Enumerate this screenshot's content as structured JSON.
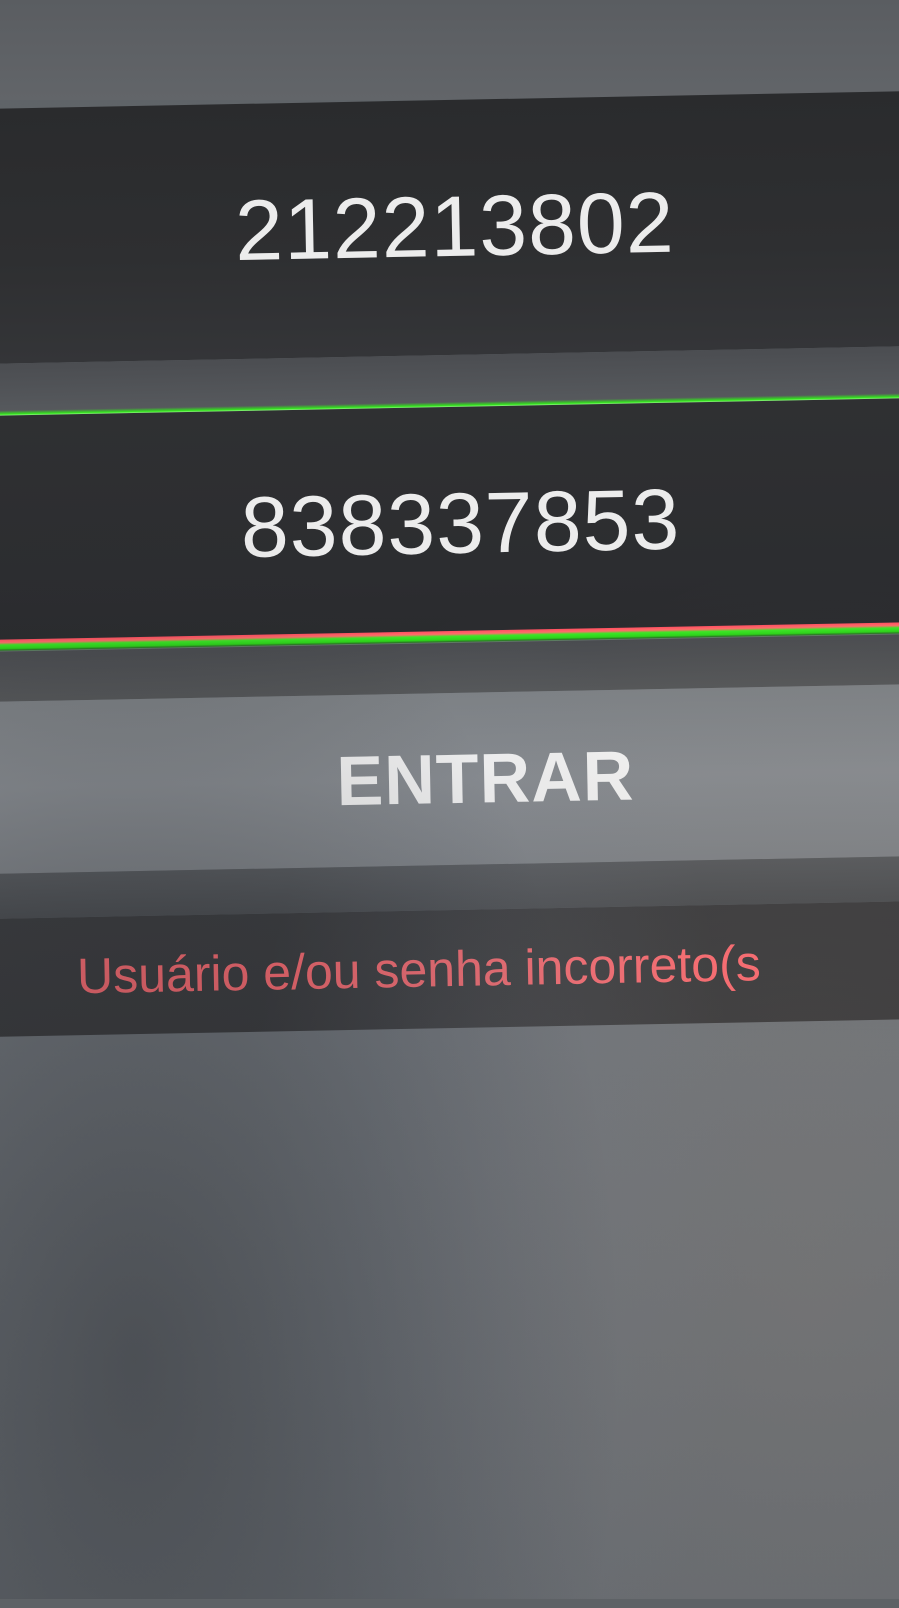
{
  "login": {
    "username_value": "212213802",
    "password_value": "838337853",
    "enter_label": "ENTRAR",
    "error_message": "Usuário e/ou senha incorreto(s"
  },
  "colors": {
    "focus_underline": "#33e51c",
    "error_underline": "#ff6b6b",
    "error_text": "#ff6b72",
    "field_bg": "#2e2f31",
    "button_bg": "#878b90"
  }
}
